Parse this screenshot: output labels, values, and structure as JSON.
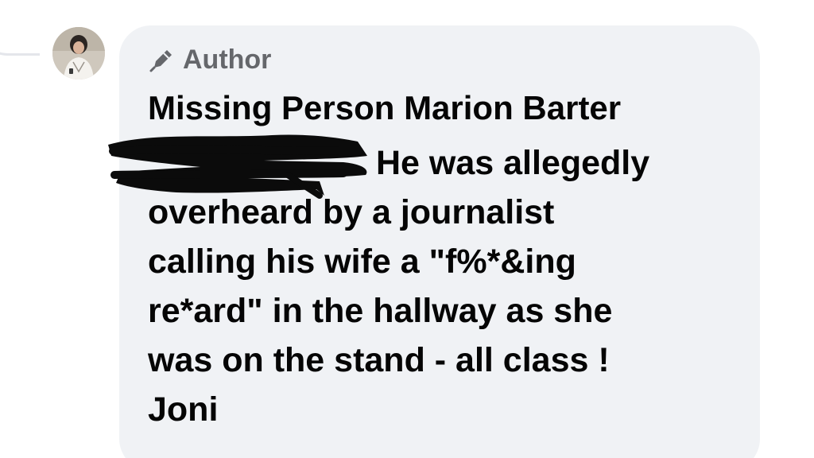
{
  "post": {
    "badge_icon": "pen-icon",
    "badge_label": "Author",
    "author_name": "Missing Person Marion Barter",
    "comment_lines": [
      "He was allegedly",
      "overheard by a journalist",
      "calling his wife a \"f%*&ing",
      "re*ard\" in the hallway as she",
      "was on the stand - all class !",
      "Joni"
    ]
  },
  "colors": {
    "bubble_bg": "#f0f2f5",
    "badge_text": "#65676b",
    "body_text": "#050505"
  }
}
